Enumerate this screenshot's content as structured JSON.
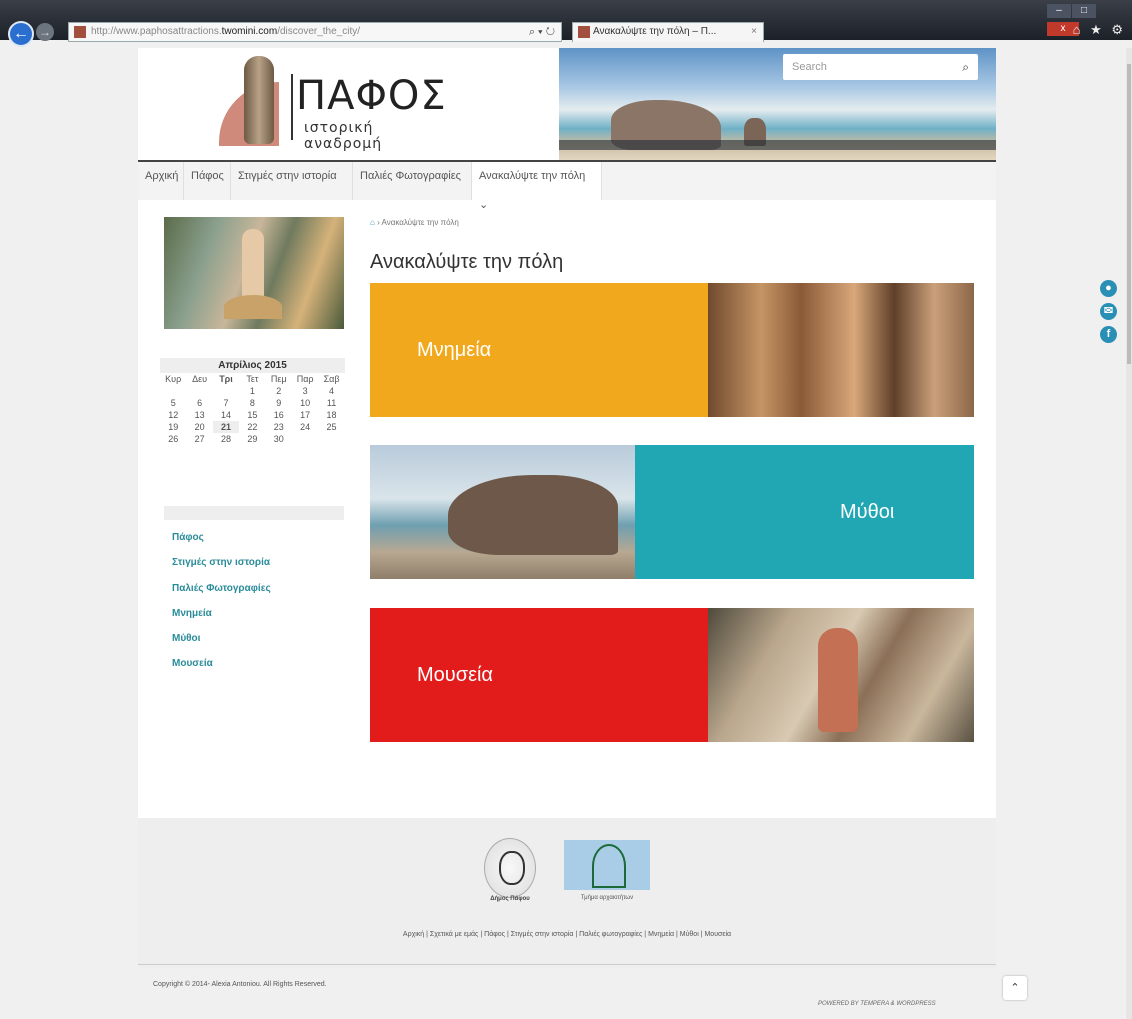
{
  "browser": {
    "url_prefix": "http://www.paphosattractions.",
    "url_domain": "twomini.com",
    "url_path": "/discover_the_city/",
    "tab_title": "Ανακαλύψτε την πόλη – Π...",
    "back_glyph": "←",
    "fwd_glyph": "→",
    "close_tab_glyph": "×",
    "addr_tools": "⌕ ▾ ↻",
    "window_buttons": [
      "–",
      "□",
      "x"
    ],
    "right_icons": "⌂ ★ ⚙"
  },
  "header": {
    "logo_title": "ΠΑΦΟΣ",
    "logo_subtitle": "ιστορική αναδρομή",
    "search_placeholder": "Search",
    "search_glyph": "⌕"
  },
  "nav": [
    {
      "label": "Αρχική"
    },
    {
      "label": "Πάφος"
    },
    {
      "label": "Στιγμές στην ιστορία"
    },
    {
      "label": "Παλιές Φωτογραφίες"
    },
    {
      "label": "Ανακαλύψτε την πόλη ⌄",
      "active": true
    }
  ],
  "breadcrumb": {
    "home_glyph": "⌂",
    "separator": "›",
    "current": "Ανακαλύψτε την πόλη"
  },
  "page_title": "Ανακαλύψτε την πόλη",
  "calendar": {
    "month": "Απρίλιος 2015",
    "weekdays": [
      "Κυρ",
      "Δευ",
      "Τρι",
      "Τετ",
      "Πεμ",
      "Παρ",
      "Σαβ"
    ],
    "weeks": [
      [
        "",
        "",
        "",
        "1",
        "2",
        "3",
        "4"
      ],
      [
        "5",
        "6",
        "7",
        "8",
        "9",
        "10",
        "11"
      ],
      [
        "12",
        "13",
        "14",
        "15",
        "16",
        "17",
        "18"
      ],
      [
        "19",
        "20",
        "21",
        "22",
        "23",
        "24",
        "25"
      ],
      [
        "26",
        "27",
        "28",
        "29",
        "30",
        "",
        ""
      ]
    ],
    "today": "21"
  },
  "sidebar_links": [
    "Πάφος",
    "Στιγμές στην ιστορία",
    "Παλιές Φωτογραφίες",
    "Μνημεία",
    "Μύθοι",
    "Μουσεία"
  ],
  "cards": {
    "monuments": "Μνημεία",
    "myths": "Μύθοι",
    "museums": "Μουσεία"
  },
  "footer": {
    "emblem1_label": "Δήμος Πάφου",
    "emblem2_label": "Τμήμα αρχαιοτήτων",
    "links": "Αρχική | Σχετικά με εμάς | Πάφος | Στιγμές στην ιστορία | Παλιές φωτογραφίες | Μνημεία | Μύθοι | Μουσεία",
    "copyright": "Copyright © 2014- Alexia Antoniou. All Rights Reserved.",
    "powered": "POWERED BY TEMPERA & WORDPRESS",
    "to_top_glyph": "⌃"
  },
  "social": [
    {
      "name": "user-icon",
      "glyph": "●"
    },
    {
      "name": "mail-icon",
      "glyph": "✉"
    },
    {
      "name": "facebook-icon",
      "glyph": "f"
    }
  ],
  "colors": {
    "monuments": "#f2a81c",
    "myths": "#21a7b4",
    "museums": "#e21b1b",
    "link": "#2a8c9a"
  }
}
